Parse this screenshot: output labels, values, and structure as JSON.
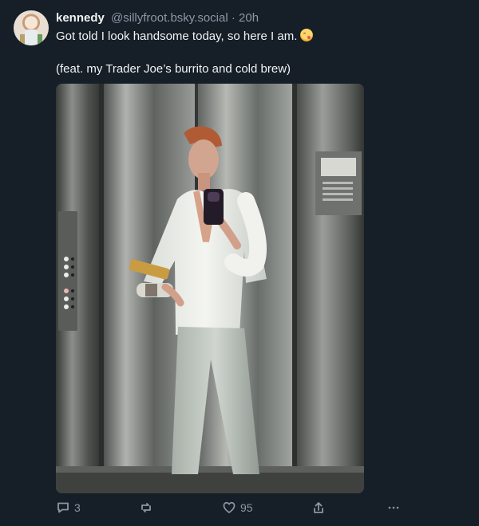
{
  "post": {
    "display_name": "kennedy",
    "handle": "@sillyfroot.bsky.social",
    "separator": "·",
    "time": "20h",
    "text_line1": "Got told I look handsome today, so here I am.",
    "text_line2": "(feat. my Trader Joe’s burrito and cold brew)",
    "emoji": "kissing-face-emoji",
    "replies": "3",
    "likes": "95"
  },
  "icons": {
    "reply": "reply-icon",
    "repost": "repost-icon",
    "like": "heart-icon",
    "share": "share-icon",
    "more": "more-icon"
  },
  "colors": {
    "background": "#161e27",
    "muted_text": "#8b98a5",
    "primary_text": "#f1f3f5"
  }
}
